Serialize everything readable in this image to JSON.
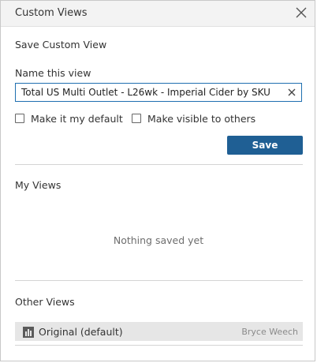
{
  "dialog": {
    "title": "Custom Views"
  },
  "save_section": {
    "title": "Save Custom View",
    "name_label": "Name this view",
    "name_value": "Total US Multi Outlet - L26wk - Imperial Cider by SKU",
    "default_checkbox_label": "Make it my default",
    "default_checked": false,
    "visible_checkbox_label": "Make visible to others",
    "visible_checked": false,
    "save_label": "Save"
  },
  "my_views": {
    "title": "My Views",
    "empty_text": "Nothing saved yet"
  },
  "other_views": {
    "title": "Other Views",
    "items": [
      {
        "name": "Original (default)",
        "owner": "Bryce Weech",
        "icon": "views-icon"
      }
    ]
  },
  "colors": {
    "accent": "#1f5f94",
    "input_border": "#1f6fb0",
    "header_bg": "#f3f3f3",
    "selected_row_bg": "#e6e6e6"
  }
}
